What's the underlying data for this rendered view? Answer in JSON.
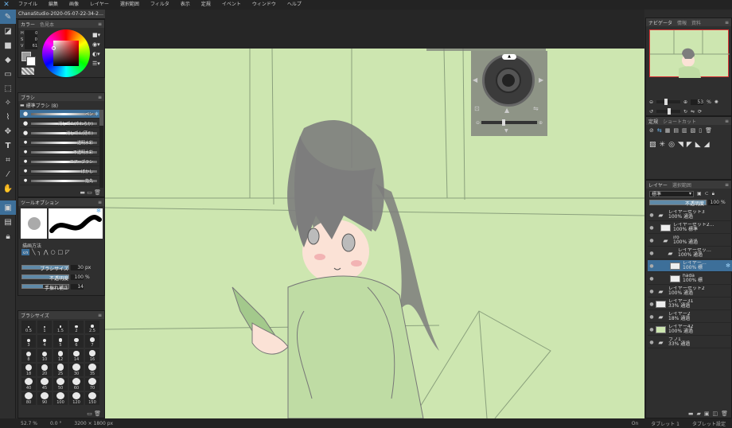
{
  "menubar": {
    "items": [
      "ファイル",
      "編集",
      "画像",
      "レイヤー",
      "選択範囲",
      "フィルタ",
      "表示",
      "定規",
      "イベント",
      "ウィンドウ",
      "ヘルプ"
    ]
  },
  "document": {
    "tab_title": "ChanaStudio-2020-05-07-22-34-2…"
  },
  "color_panel": {
    "tab1": "カラー",
    "tab2": "色見本",
    "labels": [
      "H",
      "S",
      "V"
    ],
    "values": [
      "0",
      "0",
      "61"
    ],
    "hue_ring_color": "#ff0000"
  },
  "brush_panel": {
    "title": "ブラシ",
    "group": "標準ブラシ (8)",
    "items": [
      "ペン",
      "消しゴム(やわらか)",
      "消しゴム(硬め)",
      "透明水彩",
      "不透明水彩",
      "エアーブラシ",
      "ぼかし",
      "指先"
    ]
  },
  "tool_options": {
    "title": "ツールオプション",
    "draw_method_label": "描画方法",
    "sliders": [
      {
        "label": "ブラシサイズ",
        "value": "30",
        "unit": "px"
      },
      {
        "label": "不透明度",
        "value": "100",
        "unit": "%"
      },
      {
        "label": "手振れ補正",
        "value": "14",
        "unit": ""
      }
    ]
  },
  "brush_size": {
    "title": "ブラシサイズ",
    "sizes": [
      "0.5",
      "1",
      "1.5",
      "2",
      "2.5",
      "3",
      "4",
      "5",
      "6",
      "7",
      "8",
      "10",
      "12",
      "14",
      "16",
      "18",
      "20",
      "25",
      "30",
      "35",
      "40",
      "45",
      "50",
      "60",
      "70",
      "80",
      "90",
      "100",
      "120",
      "150"
    ]
  },
  "navigator": {
    "tab1": "ナビゲータ",
    "tab2": "情報",
    "tab3": "資料",
    "zoom": "53",
    "zoom_unit": "%"
  },
  "ruler_panel": {
    "tab1": "定規",
    "tab2": "ショートカット"
  },
  "layer_panel": {
    "tab1": "レイヤー",
    "tab2": "選択範囲",
    "blend_mode": "標準",
    "opacity_label": "不透明度",
    "opacity_value": "100",
    "opacity_unit": "%",
    "layers": [
      {
        "name": "レイヤーセット3",
        "info": "100% 通過",
        "type": "folder",
        "indent": 0,
        "selected": false
      },
      {
        "name": "レイヤーセット2…",
        "info": "100% 標準",
        "type": "layer",
        "indent": 1,
        "selected": false
      },
      {
        "name": "iro",
        "info": "100% 通過",
        "type": "folder",
        "indent": 1,
        "selected": false
      },
      {
        "name": "レイヤーセッ…",
        "info": "100% 通過",
        "type": "folder",
        "indent": 2,
        "selected": false
      },
      {
        "name": "レイヤー…",
        "info": "100% 標",
        "type": "layer",
        "indent": 3,
        "selected": true
      },
      {
        "name": "hada",
        "info": "100% 標",
        "type": "layer",
        "indent": 3,
        "selected": false
      },
      {
        "name": "レイヤーセット2",
        "info": "100% 通過",
        "type": "folder",
        "indent": 0,
        "selected": false
      },
      {
        "name": "レイヤー31",
        "info": "33% 通過",
        "type": "layer",
        "indent": 0,
        "selected": false
      },
      {
        "name": "レイヤー2",
        "info": "18% 通過",
        "type": "folder",
        "indent": 0,
        "selected": false
      },
      {
        "name": "レイヤー42",
        "info": "100% 通過",
        "type": "green",
        "indent": 0,
        "selected": false
      },
      {
        "name": "ラフ1",
        "info": "33% 通過",
        "type": "folder",
        "indent": 0,
        "selected": false
      }
    ]
  },
  "statusbar": {
    "zoom": "52.7 %",
    "angle": "0.0 °",
    "size": "3200 × 1800 px",
    "toggle": "On",
    "tablet1": "タブレット 1",
    "tablet2": "タブレット設定"
  }
}
